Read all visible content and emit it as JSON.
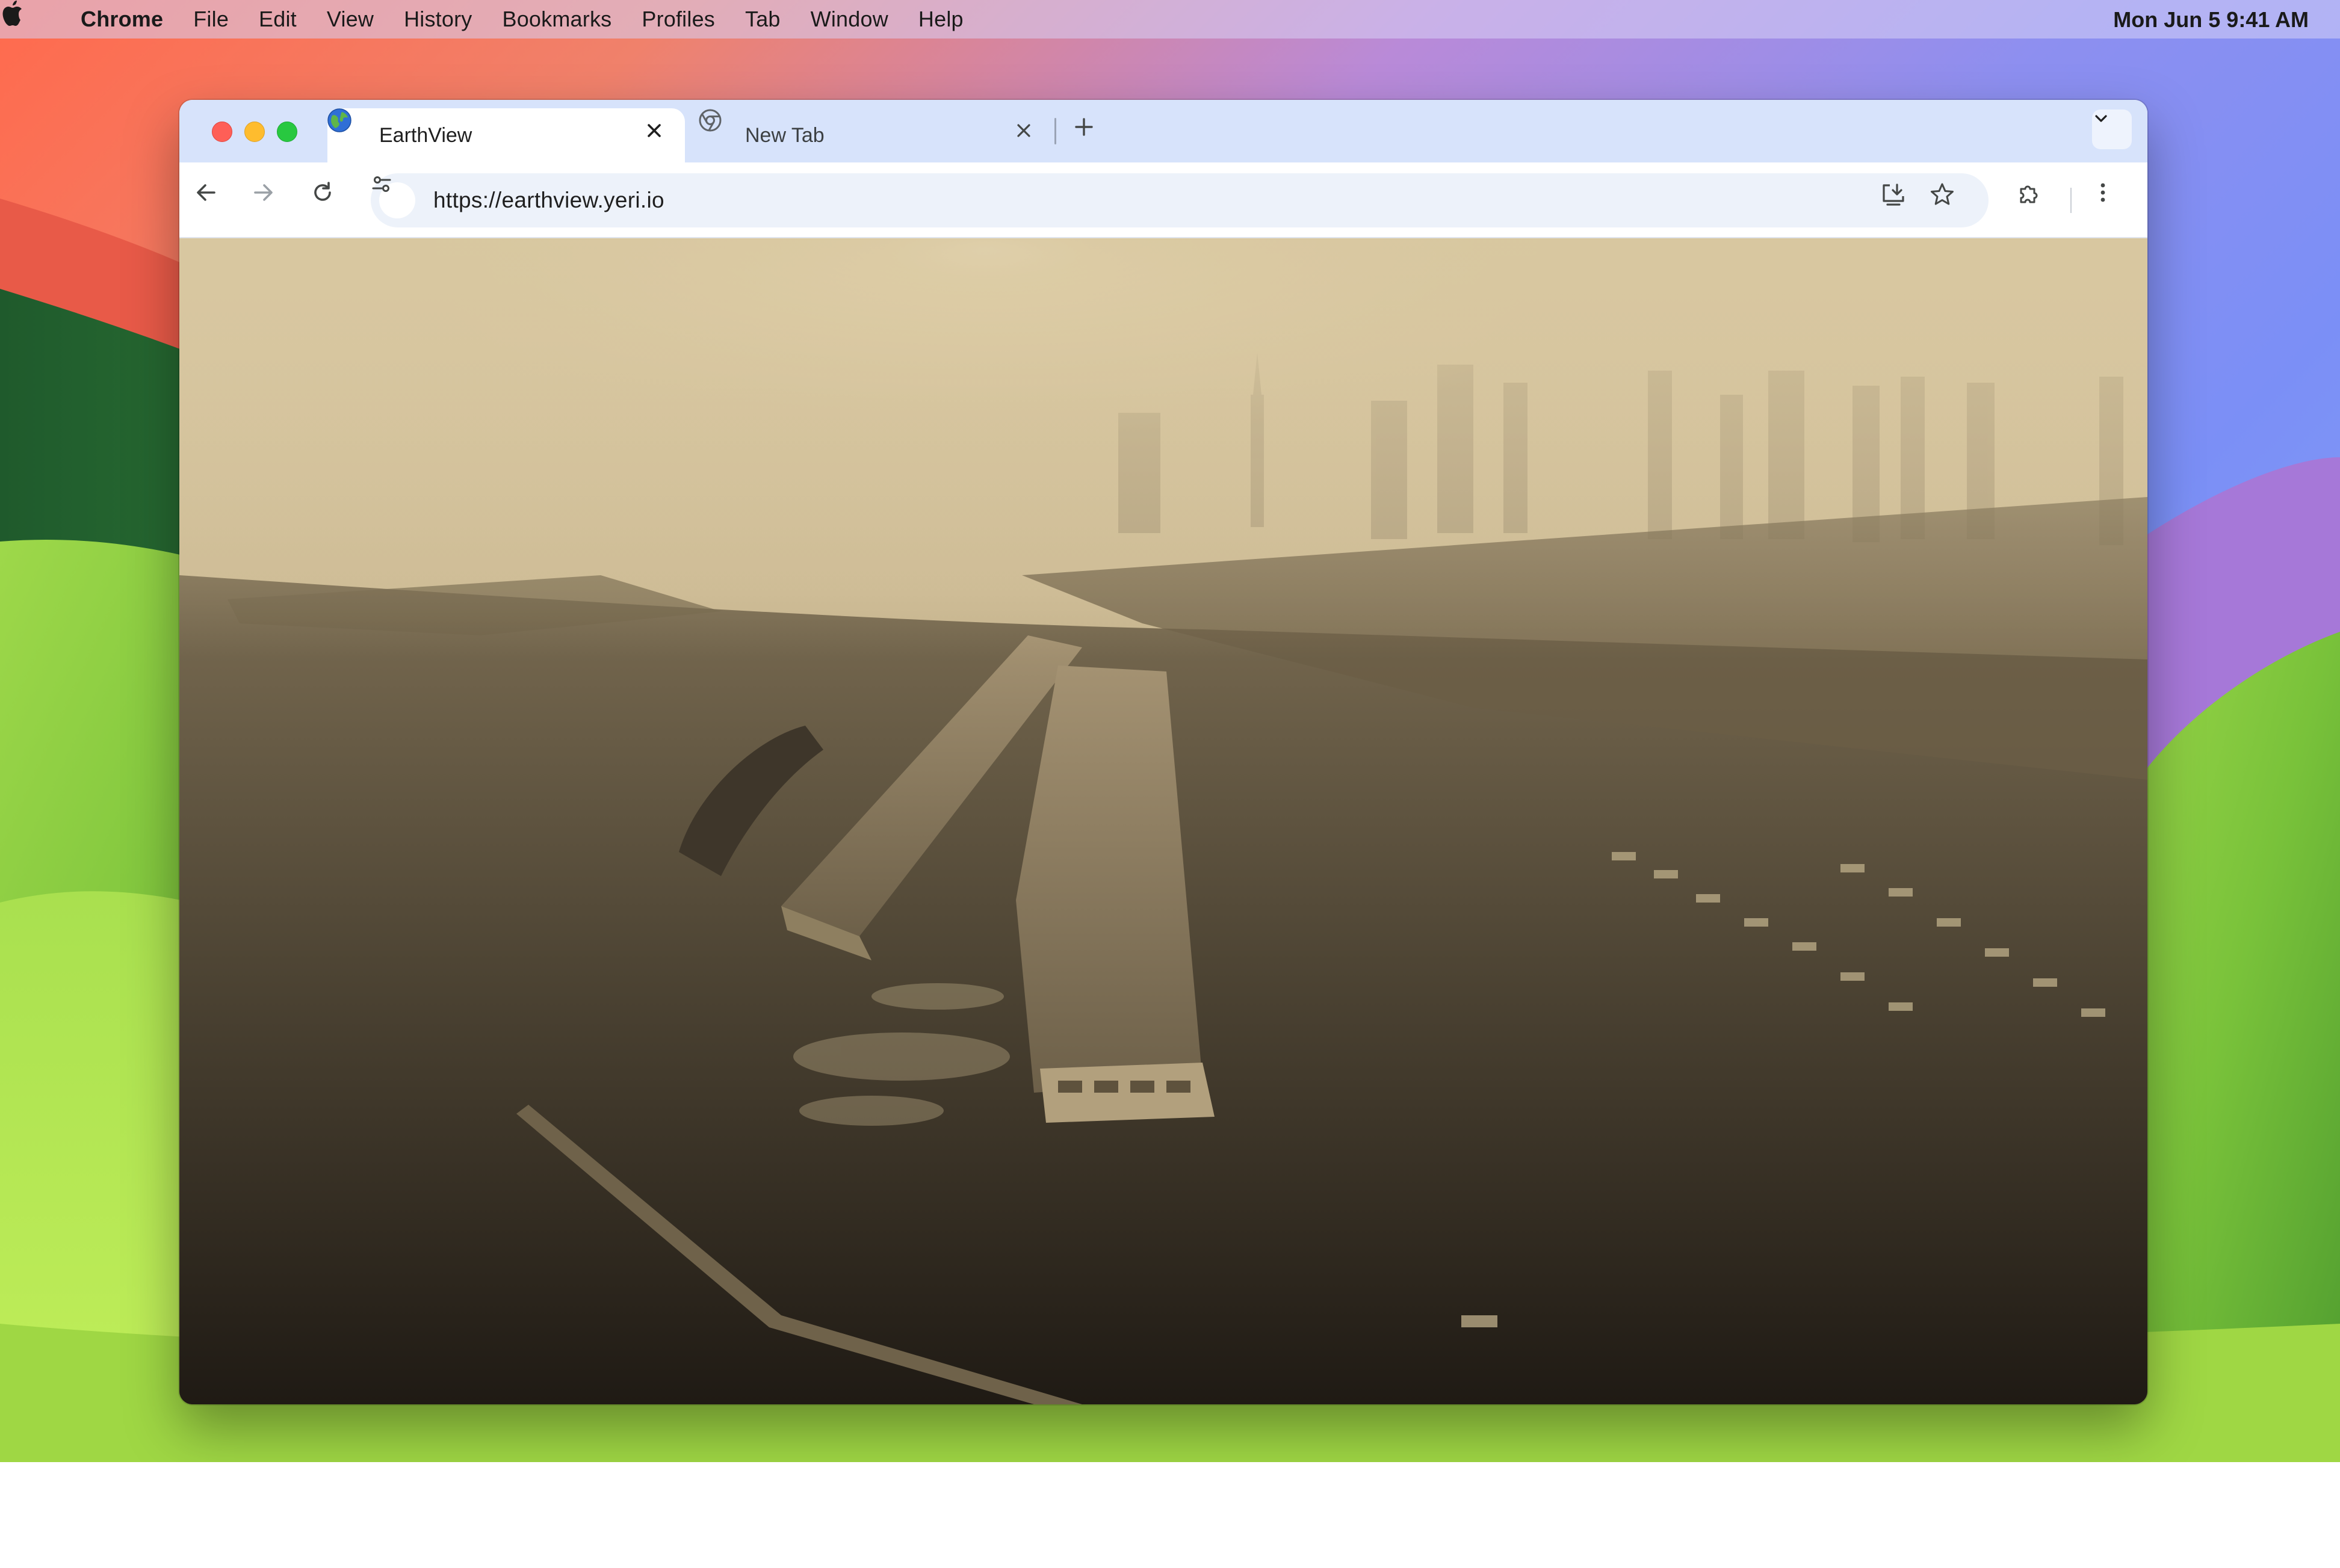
{
  "menubar": {
    "app_name": "Chrome",
    "items": [
      "File",
      "Edit",
      "View",
      "History",
      "Bookmarks",
      "Profiles",
      "Tab",
      "Window",
      "Help"
    ],
    "clock": "Mon Jun 5  9:41 AM"
  },
  "tabs": [
    {
      "title": "EarthView",
      "active": true,
      "icon": "globe-icon"
    },
    {
      "title": "New Tab",
      "active": false,
      "icon": "chrome-icon"
    }
  ],
  "toolbar": {
    "url": "https://earthview.yeri.io"
  },
  "colors": {
    "tabstrip": "#d7e3fb",
    "omnibox": "#edf2fa",
    "traffic_close": "#fe5f57",
    "traffic_min": "#febc2e",
    "traffic_max": "#28c840"
  }
}
